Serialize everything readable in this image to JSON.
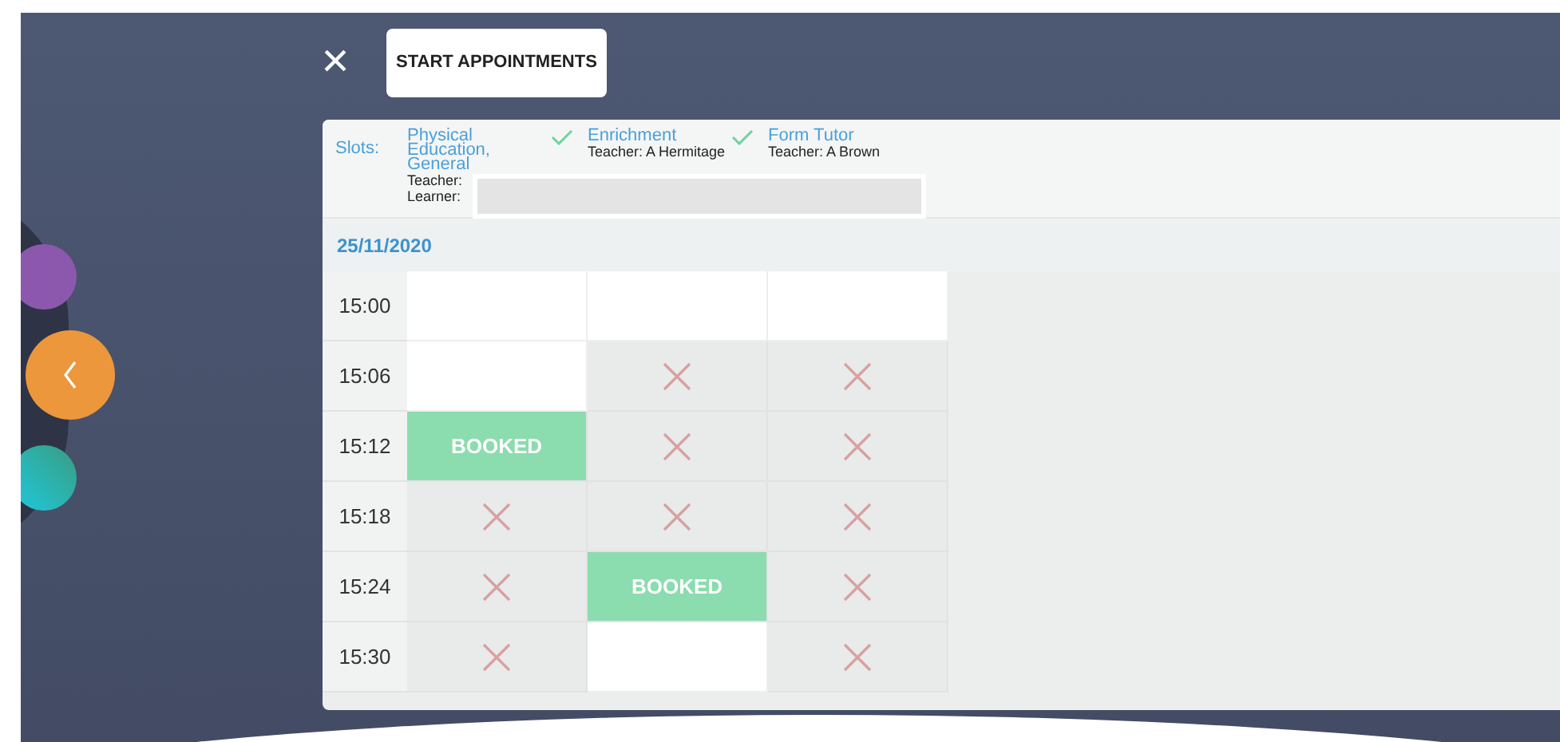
{
  "toolbar": {
    "close_label": "×",
    "start_button": "START APPOINTMENTS"
  },
  "slots": {
    "label": "Slots:",
    "items": [
      {
        "title": "Physical Education, General",
        "lines": [
          "Teacher:",
          "Learner:"
        ],
        "checked": true
      },
      {
        "title": "Enrichment",
        "lines": [
          "Teacher: A Hermitage"
        ],
        "checked": true
      },
      {
        "title": "Form Tutor",
        "lines": [
          "Teacher: A Brown"
        ],
        "checked": false
      }
    ]
  },
  "date": "25/11/2020",
  "rows": [
    {
      "time": "15:00",
      "cells": [
        {
          "kind": "free"
        },
        {
          "kind": "free"
        },
        {
          "kind": "free"
        }
      ]
    },
    {
      "time": "15:06",
      "cells": [
        {
          "kind": "free"
        },
        {
          "kind": "unavailable"
        },
        {
          "kind": "unavailable"
        }
      ]
    },
    {
      "time": "15:12",
      "cells": [
        {
          "kind": "booked",
          "label": "BOOKED"
        },
        {
          "kind": "unavailable"
        },
        {
          "kind": "unavailable"
        }
      ]
    },
    {
      "time": "15:18",
      "cells": [
        {
          "kind": "unavailable"
        },
        {
          "kind": "unavailable"
        },
        {
          "kind": "unavailable"
        }
      ]
    },
    {
      "time": "15:24",
      "cells": [
        {
          "kind": "unavailable"
        },
        {
          "kind": "booked",
          "label": "BOOKED"
        },
        {
          "kind": "unavailable"
        }
      ]
    },
    {
      "time": "15:30",
      "cells": [
        {
          "kind": "unavailable"
        },
        {
          "kind": "free"
        },
        {
          "kind": "unavailable"
        }
      ]
    }
  ]
}
